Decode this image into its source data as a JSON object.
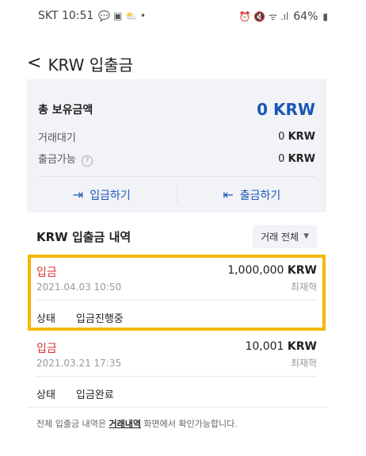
{
  "status_bar": {
    "carrier_time": "SKT 10:51",
    "left_icons": "💬 ▣ ⛅ •",
    "right_icons": "⏰ 🔇 ᯤ .ıl",
    "battery": "64%"
  },
  "header": {
    "title": "KRW 입출금"
  },
  "summary": {
    "total_label": "총 보유금액",
    "total_value": "0 KRW",
    "pending_label": "거래대기",
    "pending_value": "0",
    "withdrawable_label": "출금가능",
    "withdrawable_value": "0",
    "unit": "KRW",
    "deposit_button": "입금하기",
    "withdraw_button": "출금하기"
  },
  "history": {
    "title": "KRW 입출금 내역",
    "filter_label": "거래 전체",
    "status_label": "상태",
    "items": [
      {
        "type": "입금",
        "date": "2021.04.03 10:50",
        "amount": "1,000,000",
        "unit": "KRW",
        "action": "최재혁",
        "status": "입금진행중"
      },
      {
        "type": "입금",
        "date": "2021.03.21 17:35",
        "amount": "10,001",
        "unit": "KRW",
        "action": "최재혁",
        "status": "입금완료"
      }
    ]
  },
  "footer": {
    "prefix": "전체 입출금 내역은 ",
    "link": "거래내역",
    "suffix": " 화면에서 확인가능합니다."
  },
  "colors": {
    "accent": "#1a56b8",
    "deposit": "#d63333",
    "highlight": "#f5b800"
  }
}
